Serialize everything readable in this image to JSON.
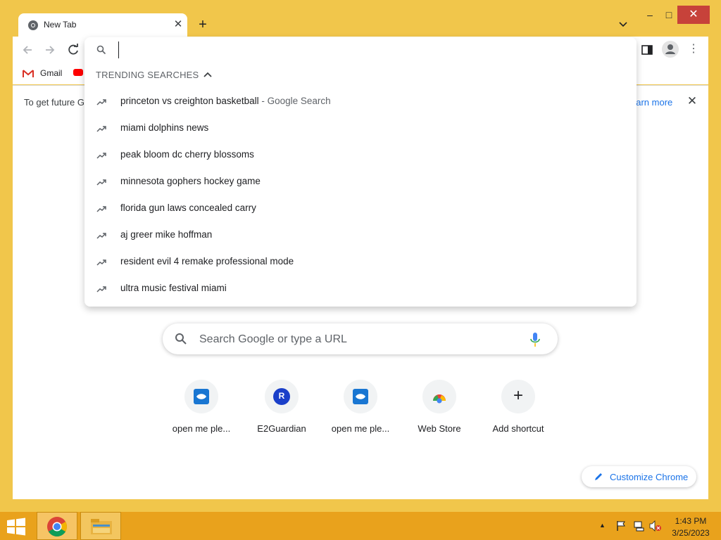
{
  "browser": {
    "tab_title": "New Tab",
    "new_tab_symbol": "+",
    "close_symbol": "✕",
    "window_buttons": {
      "minimize": "–",
      "maximize": "□",
      "close": "✕"
    },
    "menu_symbol": "⋮"
  },
  "bookmarks": {
    "gmail_label": "Gmail"
  },
  "infobar": {
    "text": "To get future G",
    "learn_more": "earn more",
    "close_symbol": "✕"
  },
  "omnibox": {
    "value": "",
    "header": "TRENDING SEARCHES",
    "suggestions": [
      {
        "text": "princeton vs creighton basketball",
        "suffix": " - Google Search"
      },
      {
        "text": "miami dolphins news",
        "suffix": ""
      },
      {
        "text": "peak bloom dc cherry blossoms",
        "suffix": ""
      },
      {
        "text": "minnesota gophers hockey game",
        "suffix": ""
      },
      {
        "text": "florida gun laws concealed carry",
        "suffix": ""
      },
      {
        "text": "aj greer mike hoffman",
        "suffix": ""
      },
      {
        "text": "resident evil 4 remake professional mode",
        "suffix": ""
      },
      {
        "text": "ultra music festival miami",
        "suffix": ""
      }
    ]
  },
  "newtab": {
    "search_placeholder": "Search Google or type a URL",
    "shortcuts": [
      {
        "label": "open me ple...",
        "icon": "fish-icon"
      },
      {
        "label": "E2Guardian",
        "icon": "letter-r-icon",
        "letter": "R"
      },
      {
        "label": "open me ple...",
        "icon": "fish-icon"
      },
      {
        "label": "Web Store",
        "icon": "web-store-icon"
      },
      {
        "label": "Add shortcut",
        "icon": "plus-icon",
        "symbol": "+"
      }
    ],
    "customize_label": "Customize Chrome"
  },
  "taskbar": {
    "time": "1:43 PM",
    "date": "3/25/2023",
    "tray_up_symbol": "▲"
  },
  "colors": {
    "window_frame": "#f1c64b",
    "taskbar": "#e9a21c",
    "accent_blue": "#1a73e8",
    "close_red": "#c7423a"
  }
}
